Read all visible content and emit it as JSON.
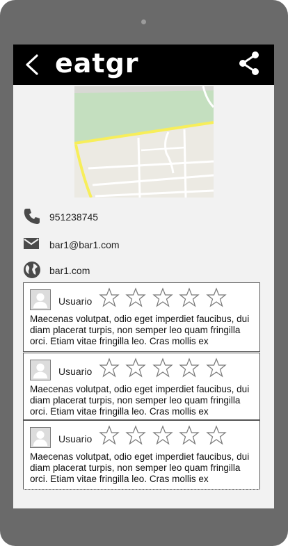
{
  "app": {
    "title": "eatgr"
  },
  "contact": {
    "phone": "951238745",
    "email": "bar1@bar1.com",
    "website": "bar1.com"
  },
  "reviews": [
    {
      "user": "Usuario",
      "rating": 0,
      "max_rating": 5,
      "text": "Maecenas volutpat, odio eget imperdiet faucibus, dui diam placerat turpis, non semper leo quam fringilla orci. Etiam vitae fringilla leo. Cras mollis ex"
    },
    {
      "user": "Usuario",
      "rating": 0,
      "max_rating": 5,
      "text": "Maecenas volutpat, odio eget imperdiet faucibus, dui diam placerat turpis, non semper leo quam fringilla orci. Etiam vitae fringilla leo. Cras mollis ex"
    },
    {
      "user": "Usuario",
      "rating": 0,
      "max_rating": 5,
      "text": "Maecenas volutpat, odio eget imperdiet faucibus, dui diam placerat turpis, non semper leo quam fringilla orci. Etiam vitae fringilla leo. Cras mollis ex"
    }
  ],
  "icons": {
    "back": "chevron-left-icon",
    "share": "share-icon",
    "phone": "phone-icon",
    "email": "envelope-icon",
    "website": "globe-icon",
    "avatar": "user-avatar-icon",
    "star": "star-outline-icon"
  },
  "colors": {
    "topbar": "#000000",
    "frame": "#6a6a6a",
    "screen": "#f2f2f2",
    "park": "#c4dfbf",
    "road_major": "#f7ee5a"
  }
}
